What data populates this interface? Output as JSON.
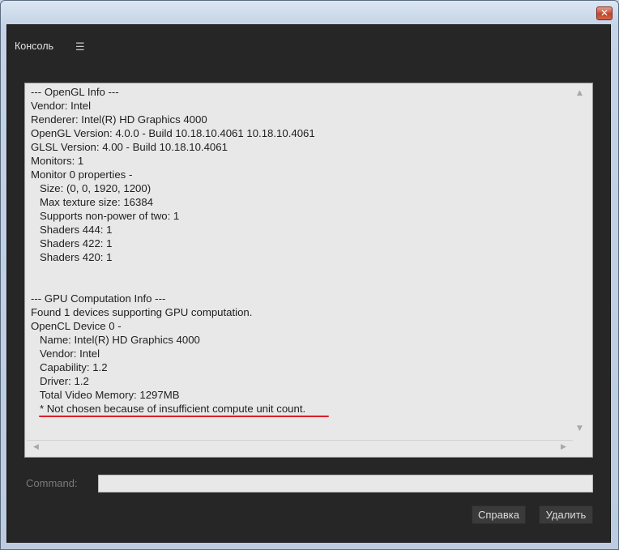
{
  "window": {
    "title": "",
    "close_glyph": "✕"
  },
  "panel": {
    "title": "Консоль",
    "menu_icon": "hamburger-menu-icon",
    "menu_glyph": "☰"
  },
  "console": {
    "lines": [
      "--- OpenGL Info ---",
      "Vendor: Intel",
      "Renderer: Intel(R) HD Graphics 4000",
      "OpenGL Version: 4.0.0 - Build 10.18.10.4061 10.18.10.4061",
      "GLSL Version: 4.00 - Build 10.18.10.4061",
      "Monitors: 1",
      "Monitor 0 properties -",
      "   Size: (0, 0, 1920, 1200)",
      "   Max texture size: 16384",
      "   Supports non-power of two: 1",
      "   Shaders 444: 1",
      "   Shaders 422: 1",
      "   Shaders 420: 1",
      "",
      "",
      "--- GPU Computation Info ---",
      "Found 1 devices supporting GPU computation.",
      "OpenCL Device 0 -",
      "   Name: Intel(R) HD Graphics 4000",
      "   Vendor: Intel",
      "   Capability: 1.2",
      "   Driver: 1.2",
      "   Total Video Memory: 1297MB",
      "   * Not chosen because of insufficient compute unit count."
    ],
    "highlight_color": "#d8202a",
    "scroll_up_glyph": "▲",
    "scroll_down_glyph": "▼",
    "scroll_left_glyph": "◀",
    "scroll_right_glyph": "▶"
  },
  "command": {
    "label": "Command:",
    "value": ""
  },
  "buttons": {
    "help_label": "Справка",
    "delete_label": "Удалить"
  },
  "colors": {
    "panel_bg": "#262626",
    "console_bg": "#e8e8e8",
    "button_bg": "#3a3a3a"
  }
}
